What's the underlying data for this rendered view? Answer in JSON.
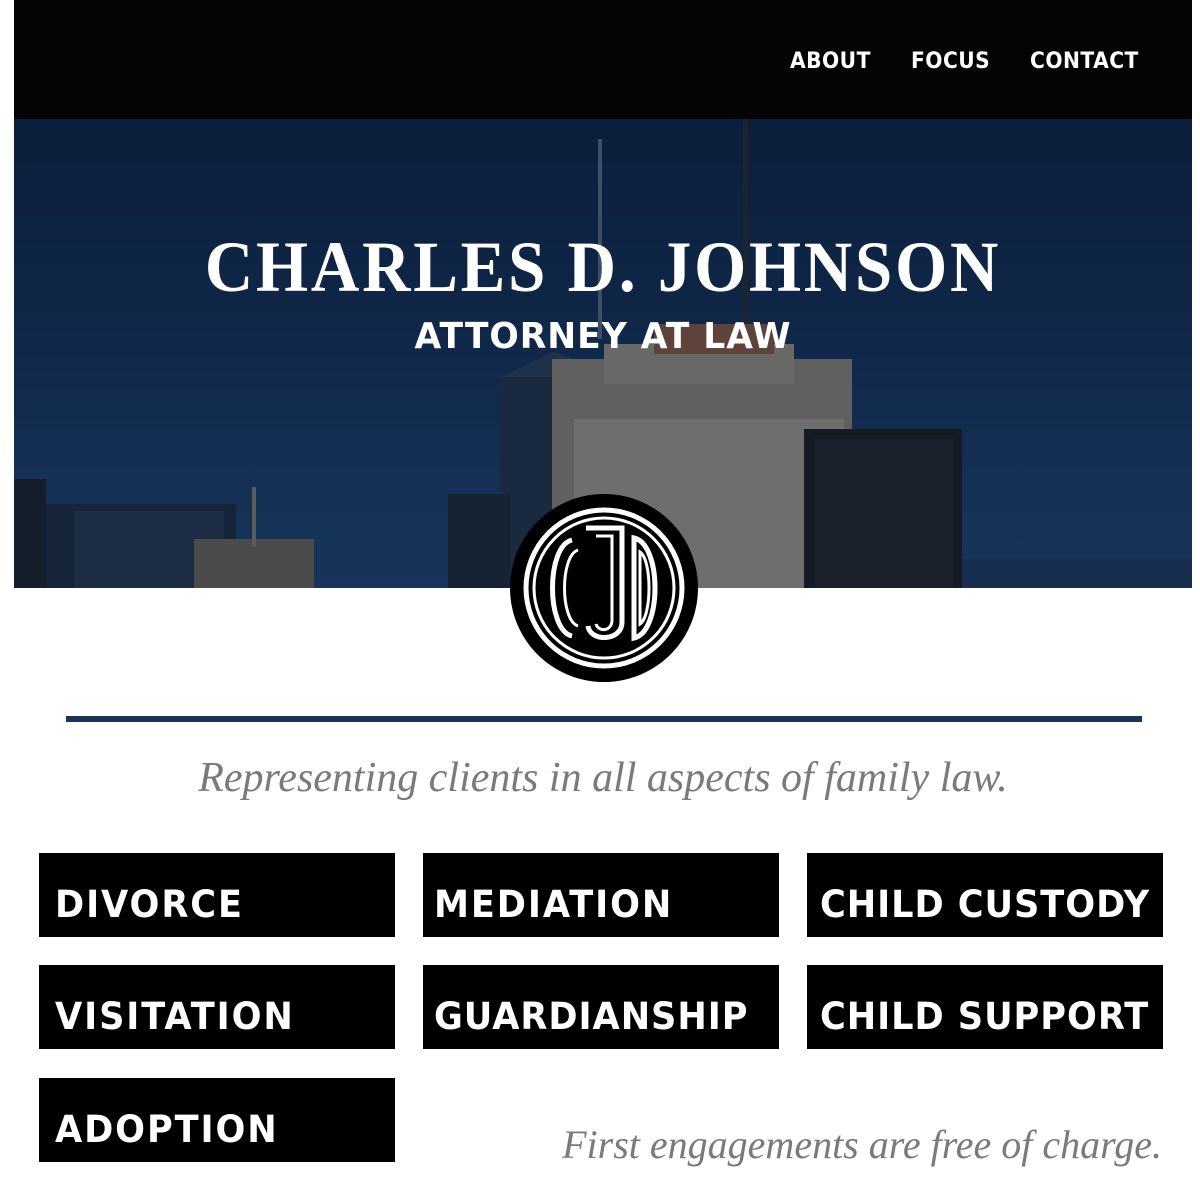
{
  "nav": {
    "items": [
      {
        "label": "ABOUT"
      },
      {
        "label": "FOCUS"
      },
      {
        "label": "CONTACT"
      }
    ]
  },
  "hero": {
    "title": "CHARLES D. JOHNSON",
    "subtitle": "ATTORNEY AT LAW"
  },
  "logo": {
    "monogram": "CJD",
    "icon": "cjd-monogram-logo"
  },
  "tagline": "Representing clients in all aspects of family law.",
  "services": [
    {
      "label": "DIVORCE"
    },
    {
      "label": "MEDIATION"
    },
    {
      "label": "CHILD CUSTODY"
    },
    {
      "label": "VISITATION"
    },
    {
      "label": "GUARDIANSHIP"
    },
    {
      "label": "CHILD SUPPORT"
    },
    {
      "label": "ADOPTION"
    }
  ],
  "note": "First engagements are free of charge.",
  "colors": {
    "navbar": "#040404",
    "divider": "#1b355a",
    "button": "#000000",
    "muted_text": "#7a7a7a"
  }
}
